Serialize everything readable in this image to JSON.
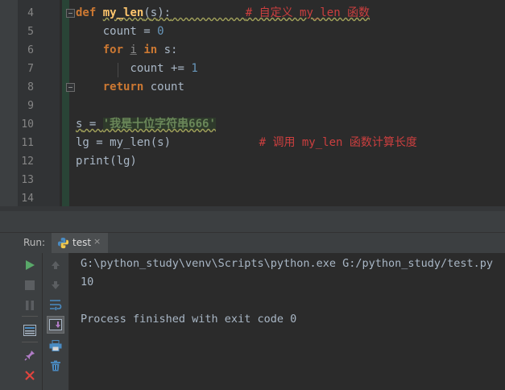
{
  "editor": {
    "lines": [
      {
        "n": "4"
      },
      {
        "n": "5"
      },
      {
        "n": "6"
      },
      {
        "n": "7"
      },
      {
        "n": "8"
      },
      {
        "n": "9"
      },
      {
        "n": "10"
      },
      {
        "n": "11"
      },
      {
        "n": "12"
      },
      {
        "n": "13"
      },
      {
        "n": "14"
      }
    ],
    "t": {
      "def": "def",
      "fname": "my_len",
      "p_open": "(",
      "param": "s",
      "p_close": "):",
      "cmt4": "# 自定义 my_len 函数",
      "count_var": "count",
      "eq0": " = ",
      "zero": "0",
      "for": "for",
      "i_var": "i",
      "in": "in",
      "s_colon": "s:",
      "count_var2": "count",
      "pluseq": " += ",
      "one": "1",
      "return": "return",
      "count_ret": "count",
      "s_assign": "s",
      "eq10": " = ",
      "str10": "'我是十位字符串666'",
      "lg_line": "lg = my_len(s)",
      "cmt11": "# 调用 my_len 函数计算长度",
      "print_line": "print(lg)"
    }
  },
  "run": {
    "label": "Run:",
    "tab": "test",
    "tab_close": "×"
  },
  "console": {
    "cmd": "G:\\python_study\\venv\\Scripts\\python.exe G:/python_study/test.py",
    "output": "10",
    "exit": "Process finished with exit code 0"
  },
  "icons": {
    "play": "play-icon",
    "stop": "stop-icon",
    "pause": "pause-icon",
    "up": "arrow-up-icon",
    "down": "arrow-down-icon",
    "wrap": "soft-wrap-icon",
    "scroll": "scroll-to-end-icon",
    "print": "print-icon",
    "trash": "trash-icon",
    "layout": "restore-layout-icon",
    "pin": "pin-icon",
    "close": "close-icon"
  }
}
